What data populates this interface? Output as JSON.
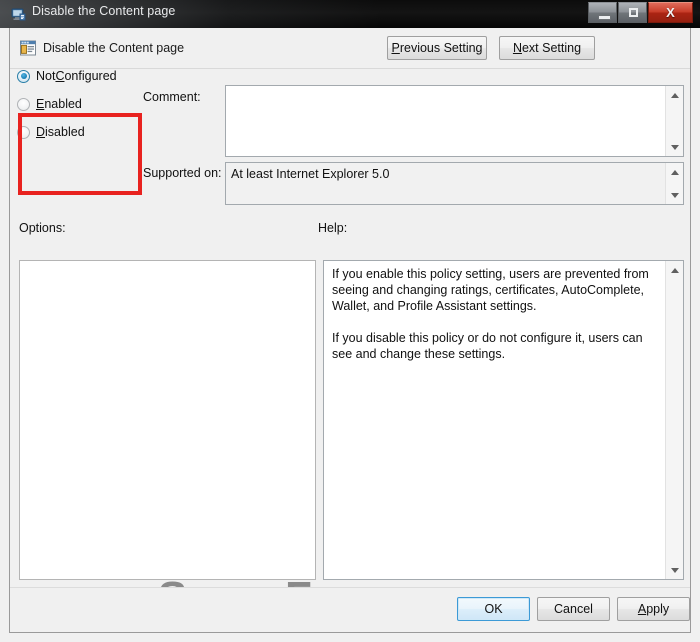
{
  "window": {
    "title": "Disable the Content page",
    "title_icon": "policy-window-icon",
    "controls": {
      "minimize": "minimize-icon",
      "maximize": "maximize-icon",
      "close": "X"
    }
  },
  "header": {
    "icon": "policy-setting-icon",
    "title": "Disable the Content page",
    "prev_button": {
      "prefix": "",
      "accel": "P",
      "rest": "revious Setting",
      "label": "Previous Setting"
    },
    "next_button": {
      "prefix": "",
      "accel": "N",
      "rest": "ext Setting",
      "label": "Next Setting"
    }
  },
  "state_options": [
    {
      "label_pre": "Not ",
      "accel": "C",
      "label_post": "onfigured",
      "label": "Not Configured",
      "checked": true
    },
    {
      "label_pre": "",
      "accel": "E",
      "label_post": "nabled",
      "label": "Enabled",
      "checked": false
    },
    {
      "label_pre": "",
      "accel": "D",
      "label_post": "isabled",
      "label": "Disabled",
      "checked": false
    }
  ],
  "comment": {
    "label": "Comment:",
    "value": "",
    "placeholder": ""
  },
  "supported": {
    "label": "Supported on:",
    "value": "At least Internet Explorer 5.0"
  },
  "options": {
    "label": "Options:",
    "value": ""
  },
  "help": {
    "label": "Help:",
    "text": "If you enable this policy setting, users are prevented from seeing and changing ratings, certificates, AutoComplete, Wallet, and Profile Assistant settings.\n\nIf you disable this policy or do not configure it, users can see and change these settings."
  },
  "footer": {
    "ok": "OK",
    "cancel": "Cancel",
    "apply_pre": "",
    "apply_accel": "A",
    "apply_post": "pply",
    "apply": "Apply"
  },
  "annotation": {
    "highlight_color": "#e8221f",
    "target": "state-radio-group"
  },
  "watermark": {
    "text": "SevenForums.com",
    "color": "#8a8a8a"
  }
}
